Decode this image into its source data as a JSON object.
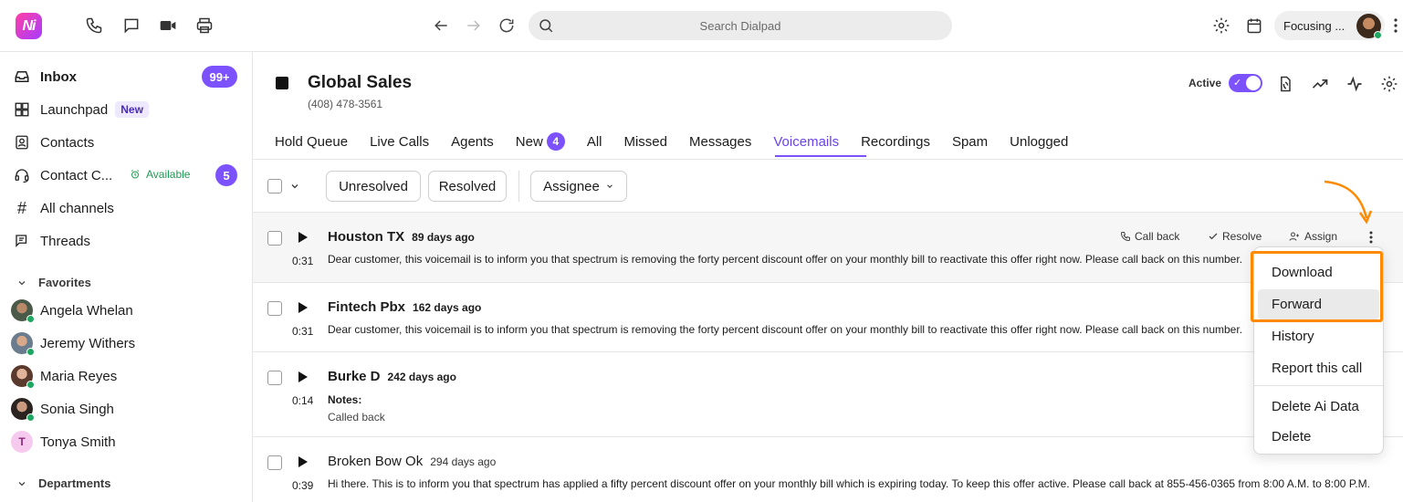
{
  "colors": {
    "accent": "#7c52ff",
    "highlight": "#ff8a00",
    "available": "#1f9b53"
  },
  "topbar": {
    "logo_text": "Ni",
    "search_placeholder": "Search Dialpad",
    "status_label": "Focusing ...",
    "icons": [
      "phone-icon",
      "chat-icon",
      "video-icon",
      "print-icon",
      "back-arrow-icon",
      "forward-arrow-icon",
      "refresh-icon",
      "search-icon",
      "settings-icon",
      "calendar-icon",
      "more-vertical-icon"
    ]
  },
  "sidebar": {
    "inbox": {
      "label": "Inbox",
      "badge": "99+"
    },
    "launchpad": {
      "label": "Launchpad",
      "tag": "New"
    },
    "contacts": {
      "label": "Contacts"
    },
    "contact_center": {
      "label": "Contact C...",
      "status": "Available",
      "badge": "5"
    },
    "all_channels": {
      "label": "All channels"
    },
    "threads": {
      "label": "Threads"
    },
    "favorites_header": "Favorites",
    "favorites": [
      {
        "name": "Angela Whelan"
      },
      {
        "name": "Jeremy Withers"
      },
      {
        "name": "Maria Reyes"
      },
      {
        "name": "Sonia Singh"
      },
      {
        "name": "Tonya Smith",
        "initial": "T"
      }
    ],
    "departments_header": "Departments"
  },
  "channel": {
    "name": "Global Sales",
    "phone": "(408) 478-3561",
    "active_label": "Active",
    "active": true
  },
  "tabs": [
    {
      "label": "Hold Queue"
    },
    {
      "label": "Live Calls"
    },
    {
      "label": "Agents"
    },
    {
      "label": "New",
      "badge": "4"
    },
    {
      "label": "All"
    },
    {
      "label": "Missed"
    },
    {
      "label": "Messages"
    },
    {
      "label": "Voicemails",
      "active": true
    },
    {
      "label": "Recordings"
    },
    {
      "label": "Spam"
    },
    {
      "label": "Unlogged"
    }
  ],
  "filters": {
    "unresolved": "Unresolved",
    "resolved": "Resolved",
    "assignee": "Assignee"
  },
  "row_actions": {
    "call_back": "Call back",
    "resolve": "Resolve",
    "assign": "Assign"
  },
  "voicemails": [
    {
      "caller": "Houston TX",
      "age": "89 days ago",
      "duration": "0:31",
      "transcript": "Dear customer, this voicemail is to inform you that spectrum is removing the forty percent discount offer on your monthly bill to reactivate this offer right now. Please call back on this number."
    },
    {
      "caller": "Fintech Pbx",
      "age": "162 days ago",
      "duration": "0:31",
      "transcript": "Dear customer, this voicemail is to inform you that spectrum is removing the forty percent discount offer on your monthly bill to reactivate this offer right now. Please call back on this number."
    },
    {
      "caller": "Burke D",
      "age": "242 days ago",
      "duration": "0:14",
      "notes_label": "Notes:",
      "notes": "Called back"
    },
    {
      "caller": "Broken Bow Ok",
      "age": "294 days ago",
      "duration": "0:39",
      "transcript": "Hi there. This is to inform you that spectrum has applied a fifty percent discount offer on your monthly bill which is expiring today. To keep this offer active. Please call back at 855-456-0365 from 8:00 A.M. to 8:00 P.M."
    }
  ],
  "context_menu": {
    "items": [
      "Download",
      "Forward",
      "History",
      "Report this call",
      "Delete Ai Data",
      "Delete"
    ],
    "hovered": "Forward"
  }
}
